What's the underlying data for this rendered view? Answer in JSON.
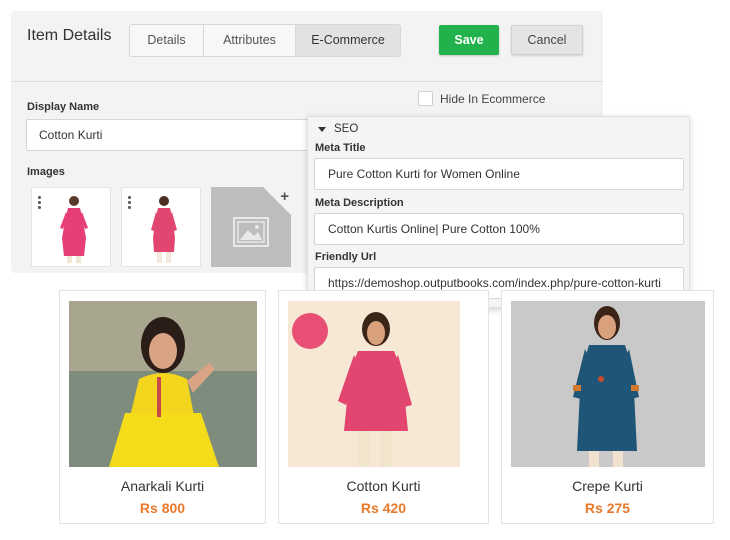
{
  "header": {
    "title": "Item Details",
    "tabs": [
      "Details",
      "Attributes",
      "E-Commerce"
    ],
    "active_tab": "E-Commerce",
    "save_label": "Save",
    "cancel_label": "Cancel"
  },
  "form": {
    "display_name_label": "Display Name",
    "display_name_value": "Cotton Kurti",
    "hide_in_ecommerce_label": "Hide In Ecommerce",
    "hide_in_ecommerce_checked": false,
    "images_label": "Images"
  },
  "seo": {
    "section_label": "SEO",
    "meta_title_label": "Meta Title",
    "meta_title_value": "Pure Cotton Kurti for Women Online",
    "meta_description_label": "Meta Description",
    "meta_description_value": "Cotton Kurtis Online| Pure Cotton 100%",
    "friendly_url_label": "Friendly Url",
    "friendly_url_value": "https://demoshop.outputbooks.com/index.php/pure-cotton-kurti"
  },
  "products": [
    {
      "name": "Anarkali Kurti",
      "price": "Rs 800"
    },
    {
      "name": "Cotton Kurti",
      "price": "Rs 420"
    },
    {
      "name": "Crepe Kurti",
      "price": "Rs 275"
    }
  ],
  "colors": {
    "save_green": "#21b24b",
    "price_orange": "#e8792b",
    "panel_bg": "#f3f3f3"
  }
}
